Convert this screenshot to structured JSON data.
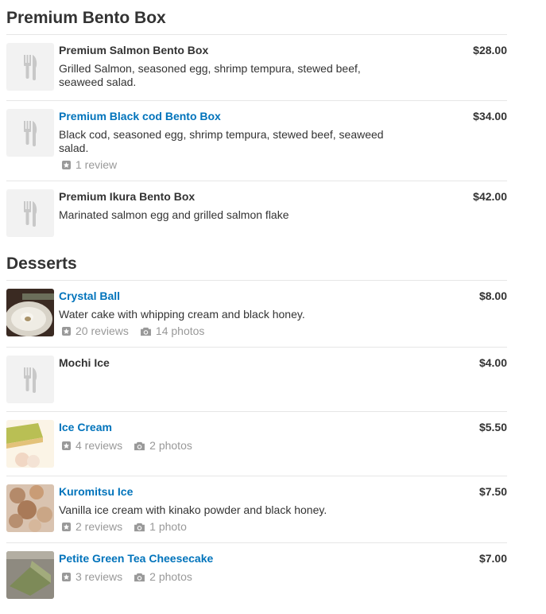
{
  "sections": [
    {
      "title": "Premium Bento Box",
      "items": [
        {
          "name": "Premium Salmon Bento Box",
          "price": "$28.00",
          "desc": "Grilled Salmon, seasoned egg, shrimp tempura, stewed beef, seaweed salad."
        },
        {
          "name": "Premium Black cod Bento Box",
          "price": "$34.00",
          "desc": "Black cod, seasoned egg, shrimp tempura, stewed beef, seaweed salad.",
          "reviews": "1 review"
        },
        {
          "name": "Premium Ikura Bento Box",
          "price": "$42.00",
          "desc": "Marinated salmon egg and grilled salmon flake"
        }
      ]
    },
    {
      "title": "Desserts",
      "items": [
        {
          "name": "Crystal Ball",
          "price": "$8.00",
          "desc": "Water cake with whipping cream and black honey.",
          "reviews": "20 reviews",
          "photos": "14 photos"
        },
        {
          "name": "Mochi Ice",
          "price": "$4.00"
        },
        {
          "name": "Ice Cream",
          "price": "$5.50",
          "reviews": "4 reviews",
          "photos": "2 photos"
        },
        {
          "name": "Kuromitsu Ice",
          "price": "$7.50",
          "desc": "Vanilla ice cream with kinako powder and black honey.",
          "reviews": "2 reviews",
          "photos": "1 photo"
        },
        {
          "name": "Petite Green Tea Cheesecake",
          "price": "$7.00",
          "reviews": "3 reviews",
          "photos": "2 photos"
        }
      ]
    }
  ],
  "colors": {
    "link": "#0073bb",
    "text": "#333333",
    "muted": "#999999",
    "divider": "#e6e6e6"
  }
}
